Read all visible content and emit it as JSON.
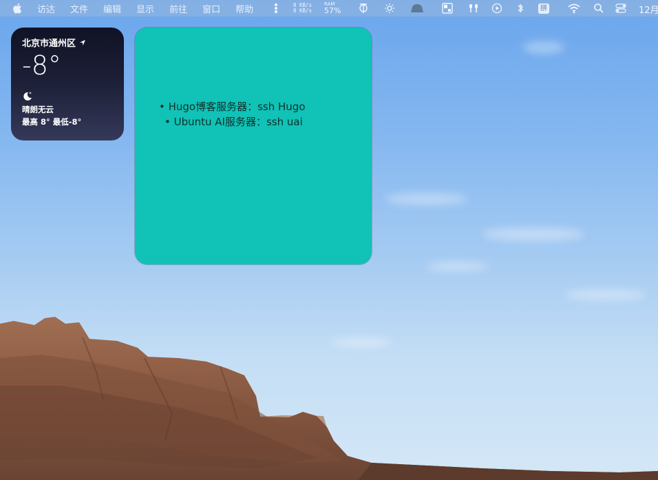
{
  "menubar": {
    "menus": [
      "访达",
      "文件",
      "编辑",
      "显示",
      "前往",
      "窗口",
      "帮助"
    ],
    "net_up": "0 KB/s",
    "net_down": "0 KB/s",
    "ram_label": "RAM",
    "ram_value": "57%",
    "input_method": "拼",
    "clock": "12月",
    "icons": [
      "apple-icon",
      "menu-dots-icon",
      "network-icon",
      "brightness-icon",
      "mask-icon",
      "window-layout-icon",
      "airpods-icon",
      "play-icon",
      "bluetooth-icon",
      "wifi-icon",
      "search-icon",
      "control-center-icon"
    ]
  },
  "weather": {
    "location": "北京市通州区",
    "temperature": "-8°",
    "condition": "晴朗无云",
    "range": "最高 8° 最低-8°",
    "icons": [
      "location-arrow-icon",
      "moon-icon"
    ]
  },
  "note": {
    "lines": [
      "• Hugo博客服务器：ssh Hugo",
      "• Ubuntu AI服务器：ssh uai"
    ],
    "background": "#11c2b6"
  }
}
